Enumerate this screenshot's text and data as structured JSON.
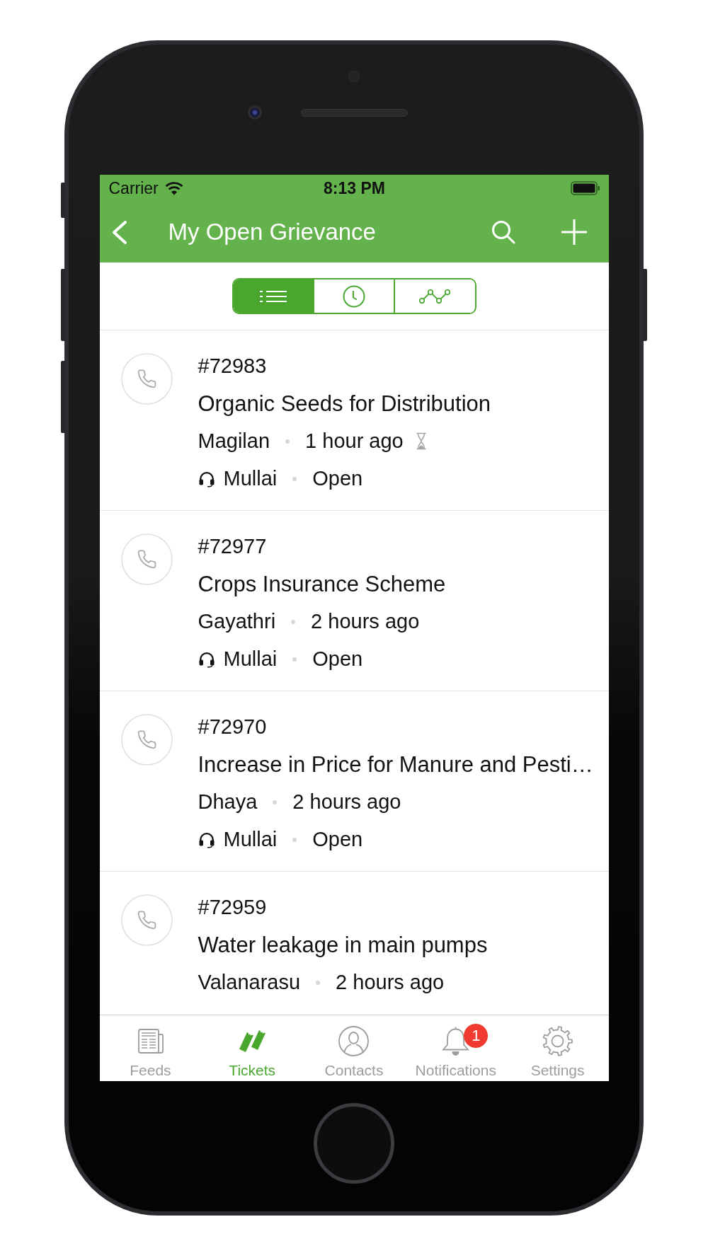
{
  "status_bar": {
    "carrier": "Carrier",
    "time": "8:13 PM"
  },
  "nav_bar": {
    "title": "My Open Grievance"
  },
  "view_switcher": [
    {
      "kind": "list",
      "selected": true
    },
    {
      "kind": "clock",
      "selected": false
    },
    {
      "kind": "chart",
      "selected": false
    }
  ],
  "tickets": [
    {
      "id": "#72983",
      "title": "Organic Seeds for Distribution",
      "requester": "Magilan",
      "time": "1 hour ago",
      "pending": true,
      "assignee": "Mullai",
      "status": "Open"
    },
    {
      "id": "#72977",
      "title": "Crops Insurance Scheme",
      "requester": "Gayathri",
      "time": "2 hours ago",
      "pending": false,
      "assignee": "Mullai",
      "status": "Open"
    },
    {
      "id": "#72970",
      "title": "Increase in Price for Manure and Pesti…",
      "requester": "Dhaya",
      "time": "2 hours ago",
      "pending": false,
      "assignee": "Mullai",
      "status": "Open"
    },
    {
      "id": "#72959",
      "title": "Water leakage in main pumps",
      "requester": "Valanarasu",
      "time": "2 hours ago",
      "pending": false
    }
  ],
  "tab_bar": [
    {
      "label": "Feeds",
      "kind": "feeds",
      "selected": false
    },
    {
      "label": "Tickets",
      "kind": "tickets",
      "selected": true
    },
    {
      "label": "Contacts",
      "kind": "contacts",
      "selected": false
    },
    {
      "label": "Notifications",
      "kind": "notifications",
      "selected": false,
      "badge": "1"
    },
    {
      "label": "Settings",
      "kind": "settings",
      "selected": false
    }
  ]
}
